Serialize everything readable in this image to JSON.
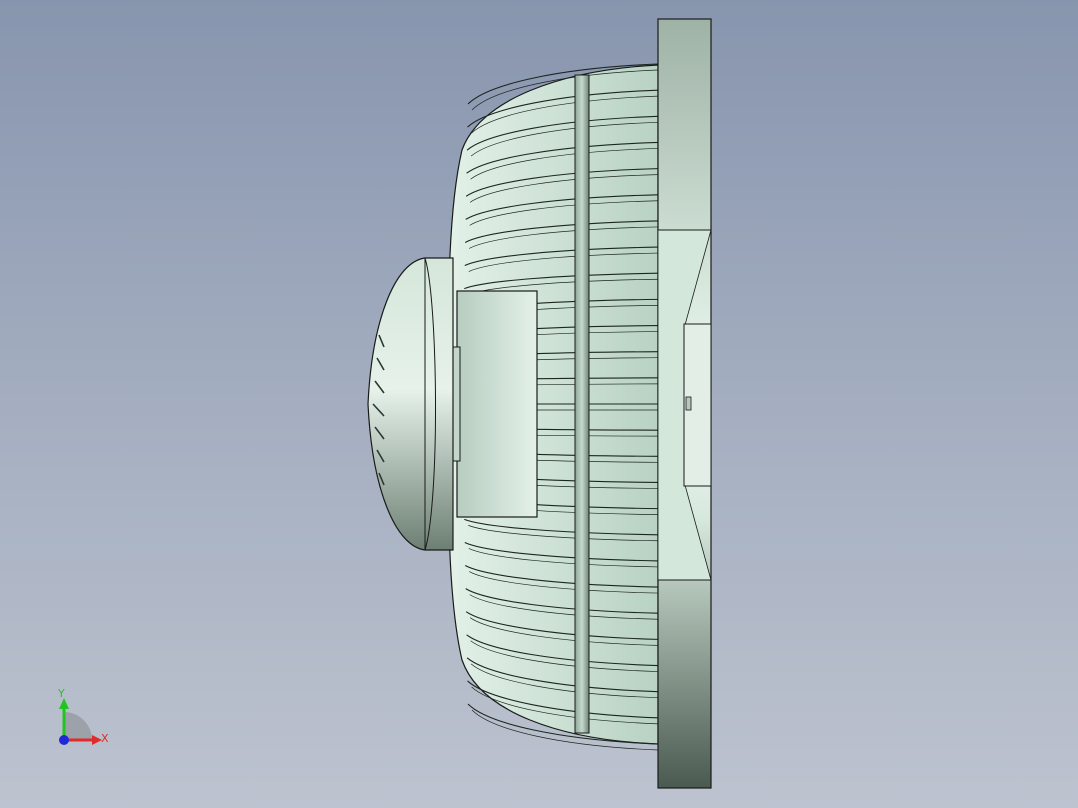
{
  "viewport": {
    "background_top": "#8795ae",
    "background_bottom": "#bdc3cf"
  },
  "model": {
    "view": "side",
    "body_color": "#c9e3d6",
    "edge_color": "#000000"
  },
  "triad": {
    "x_label": "X",
    "y_label": "Y",
    "x_color": "#e12a2a",
    "y_color": "#22c422",
    "z_color": "#1f2ad4"
  }
}
